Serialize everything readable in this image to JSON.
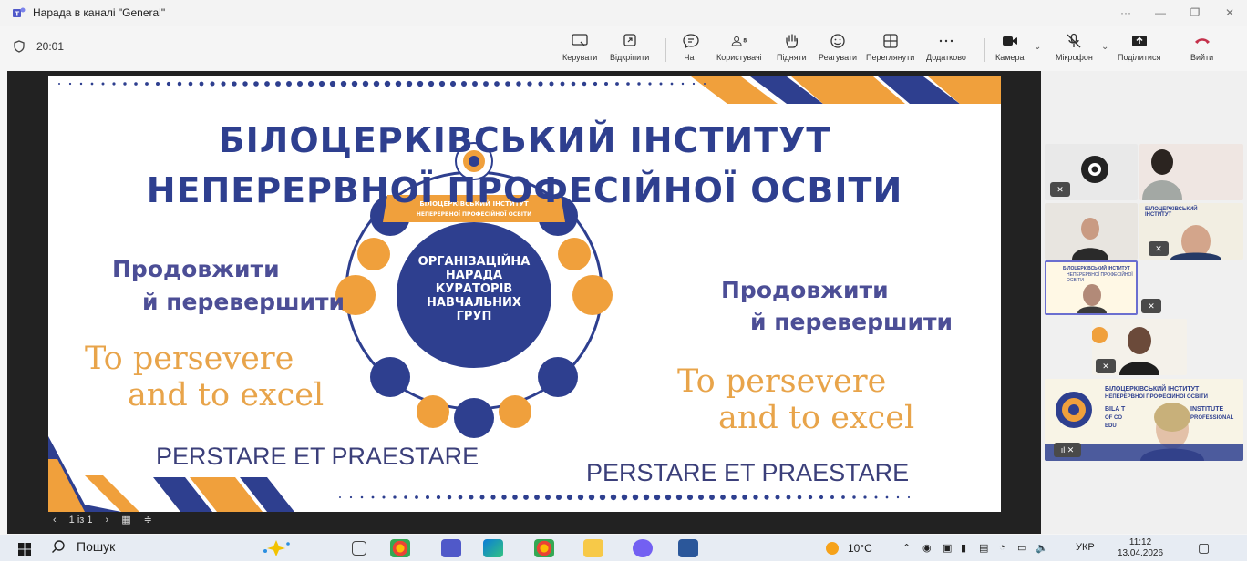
{
  "window": {
    "title": "Нарада в каналі \"General\""
  },
  "toolbar": {
    "timer": "20:01",
    "participants_count": "8",
    "buttons": {
      "manage": "Керувати",
      "unpin": "Відкріпити",
      "chat": "Чат",
      "users": "Користувачі",
      "raise": "Підняти",
      "react": "Реагувати",
      "view": "Переглянути",
      "more": "Додатково",
      "camera": "Камера",
      "mic": "Мікрофон",
      "share": "Поділитися",
      "leave": "Вийти"
    }
  },
  "slide": {
    "title_line1": "БІЛОЦЕРКІВСЬКИЙ  ІНСТИТУТ",
    "title_line2": "НЕПЕРЕРВНОЇ ПРОФЕСІЙНОЇ ОСВІТИ",
    "motto_ua_line1": "Продовжити",
    "motto_ua_line2": "й перевершити",
    "motto_en_line1": "To persevere",
    "motto_en_line2": "and to excel",
    "motto_la": "PERSTARE ET PRAESTARE",
    "emblem_banner_line1": "БІЛОЦЕРКІВСЬКИЙ ІНСТИТУТ",
    "emblem_banner_line2": "НЕПЕРЕРВНОЇ ПРОФЕСІЙНОЇ ОСВІТИ",
    "emblem_center": [
      "ОРГАНІЗАЦІЙНА",
      "НАРАДА",
      "КУРАТОРІВ",
      "НАВЧАЛЬНИХ",
      "ГРУП"
    ]
  },
  "pager": {
    "label": "1 із 1"
  },
  "side_tiles": {
    "tile_text_1": "БІЛОЦЕРКІВСЬКИЙ ІНСТИТУТ",
    "tile_text_2": "НЕПЕРЕРВНОЇ ПРОФЕСІЙНОЇ ОСВІТИ",
    "tile_text_3": "BILA T",
    "tile_text_4": "INSTITUTE",
    "tile_text_5": "OF CO",
    "tile_text_6": "PROFESSIONAL",
    "tile_text_7": "EDU"
  },
  "taskbar": {
    "search_label": "Пошук",
    "temperature": "10°C",
    "language": "УКР",
    "time": "11:12",
    "date": "13.04.2026"
  },
  "colors": {
    "navy": "#2e3f8f",
    "orange": "#f0a03c",
    "purple_text": "#4c4e96",
    "stage_bg": "#222222"
  }
}
